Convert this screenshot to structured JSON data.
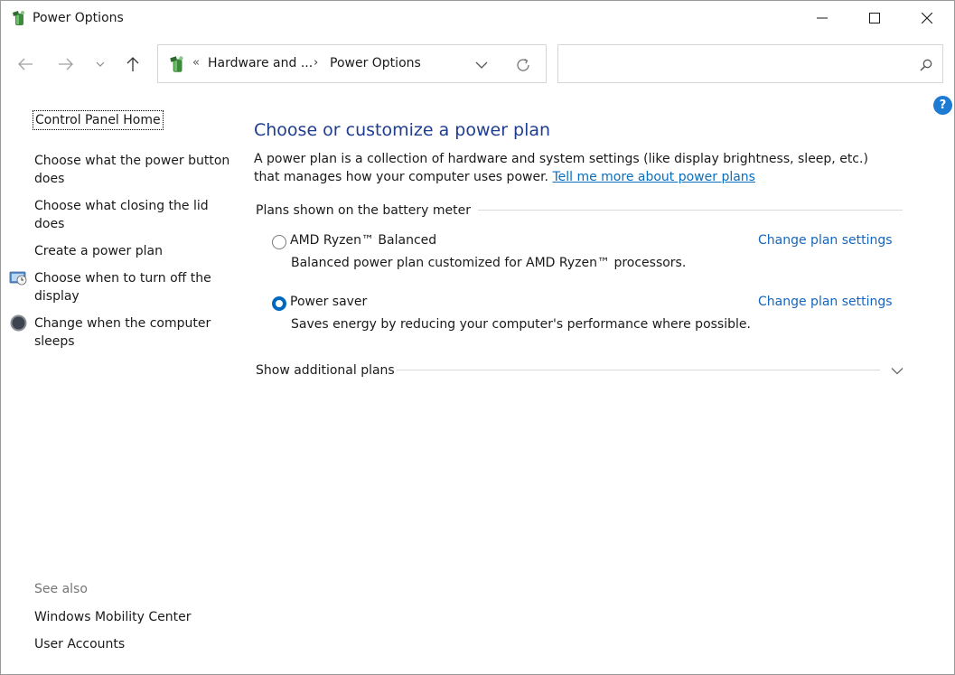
{
  "window": {
    "title": "Power Options",
    "icon": "power-options-icon"
  },
  "nav": {
    "breadcrumb_overflow": "«",
    "breadcrumb_1": "Hardware and ...",
    "breadcrumb_separator": "›",
    "breadcrumb_2": "Power Options",
    "search_placeholder": ""
  },
  "help": {
    "label": "?"
  },
  "sidebar": {
    "home": "Control Panel Home",
    "items": [
      {
        "label_line1": "Choose what the power button",
        "label_line2": "does"
      },
      {
        "label_line1": "Choose what closing the lid",
        "label_line2": "does"
      },
      {
        "label": "Create a power plan"
      },
      {
        "label_line1": "Choose when to turn off the",
        "label_line2": "display",
        "icon": "display-clock-icon"
      },
      {
        "label_line1": "Change when the computer",
        "label_line2": "sleeps",
        "icon": "moon-sleep-icon"
      }
    ],
    "see_also_heading": "See also",
    "see_also": [
      "Windows Mobility Center",
      "User Accounts"
    ]
  },
  "main": {
    "title": "Choose or customize a power plan",
    "description": "A power plan is a collection of hardware and system settings (like display brightness, sleep, etc.) that manages how your computer uses power.",
    "learn_more": "Tell me more about power plans",
    "group_label": "Plans shown on the battery meter",
    "plans": [
      {
        "name": "AMD Ryzen™ Balanced",
        "description": "Balanced power plan customized for AMD Ryzen™ processors.",
        "link": "Change plan settings",
        "selected": false
      },
      {
        "name": "Power saver",
        "description": "Saves energy by reducing your computer's performance where possible.",
        "link": "Change plan settings",
        "selected": true
      }
    ],
    "show_additional": "Show additional plans"
  },
  "colors": {
    "title_blue": "#1e3d8f",
    "link_blue": "#1565c0",
    "radio_accent": "#0067c0",
    "help_blue": "#1e7bd4"
  }
}
